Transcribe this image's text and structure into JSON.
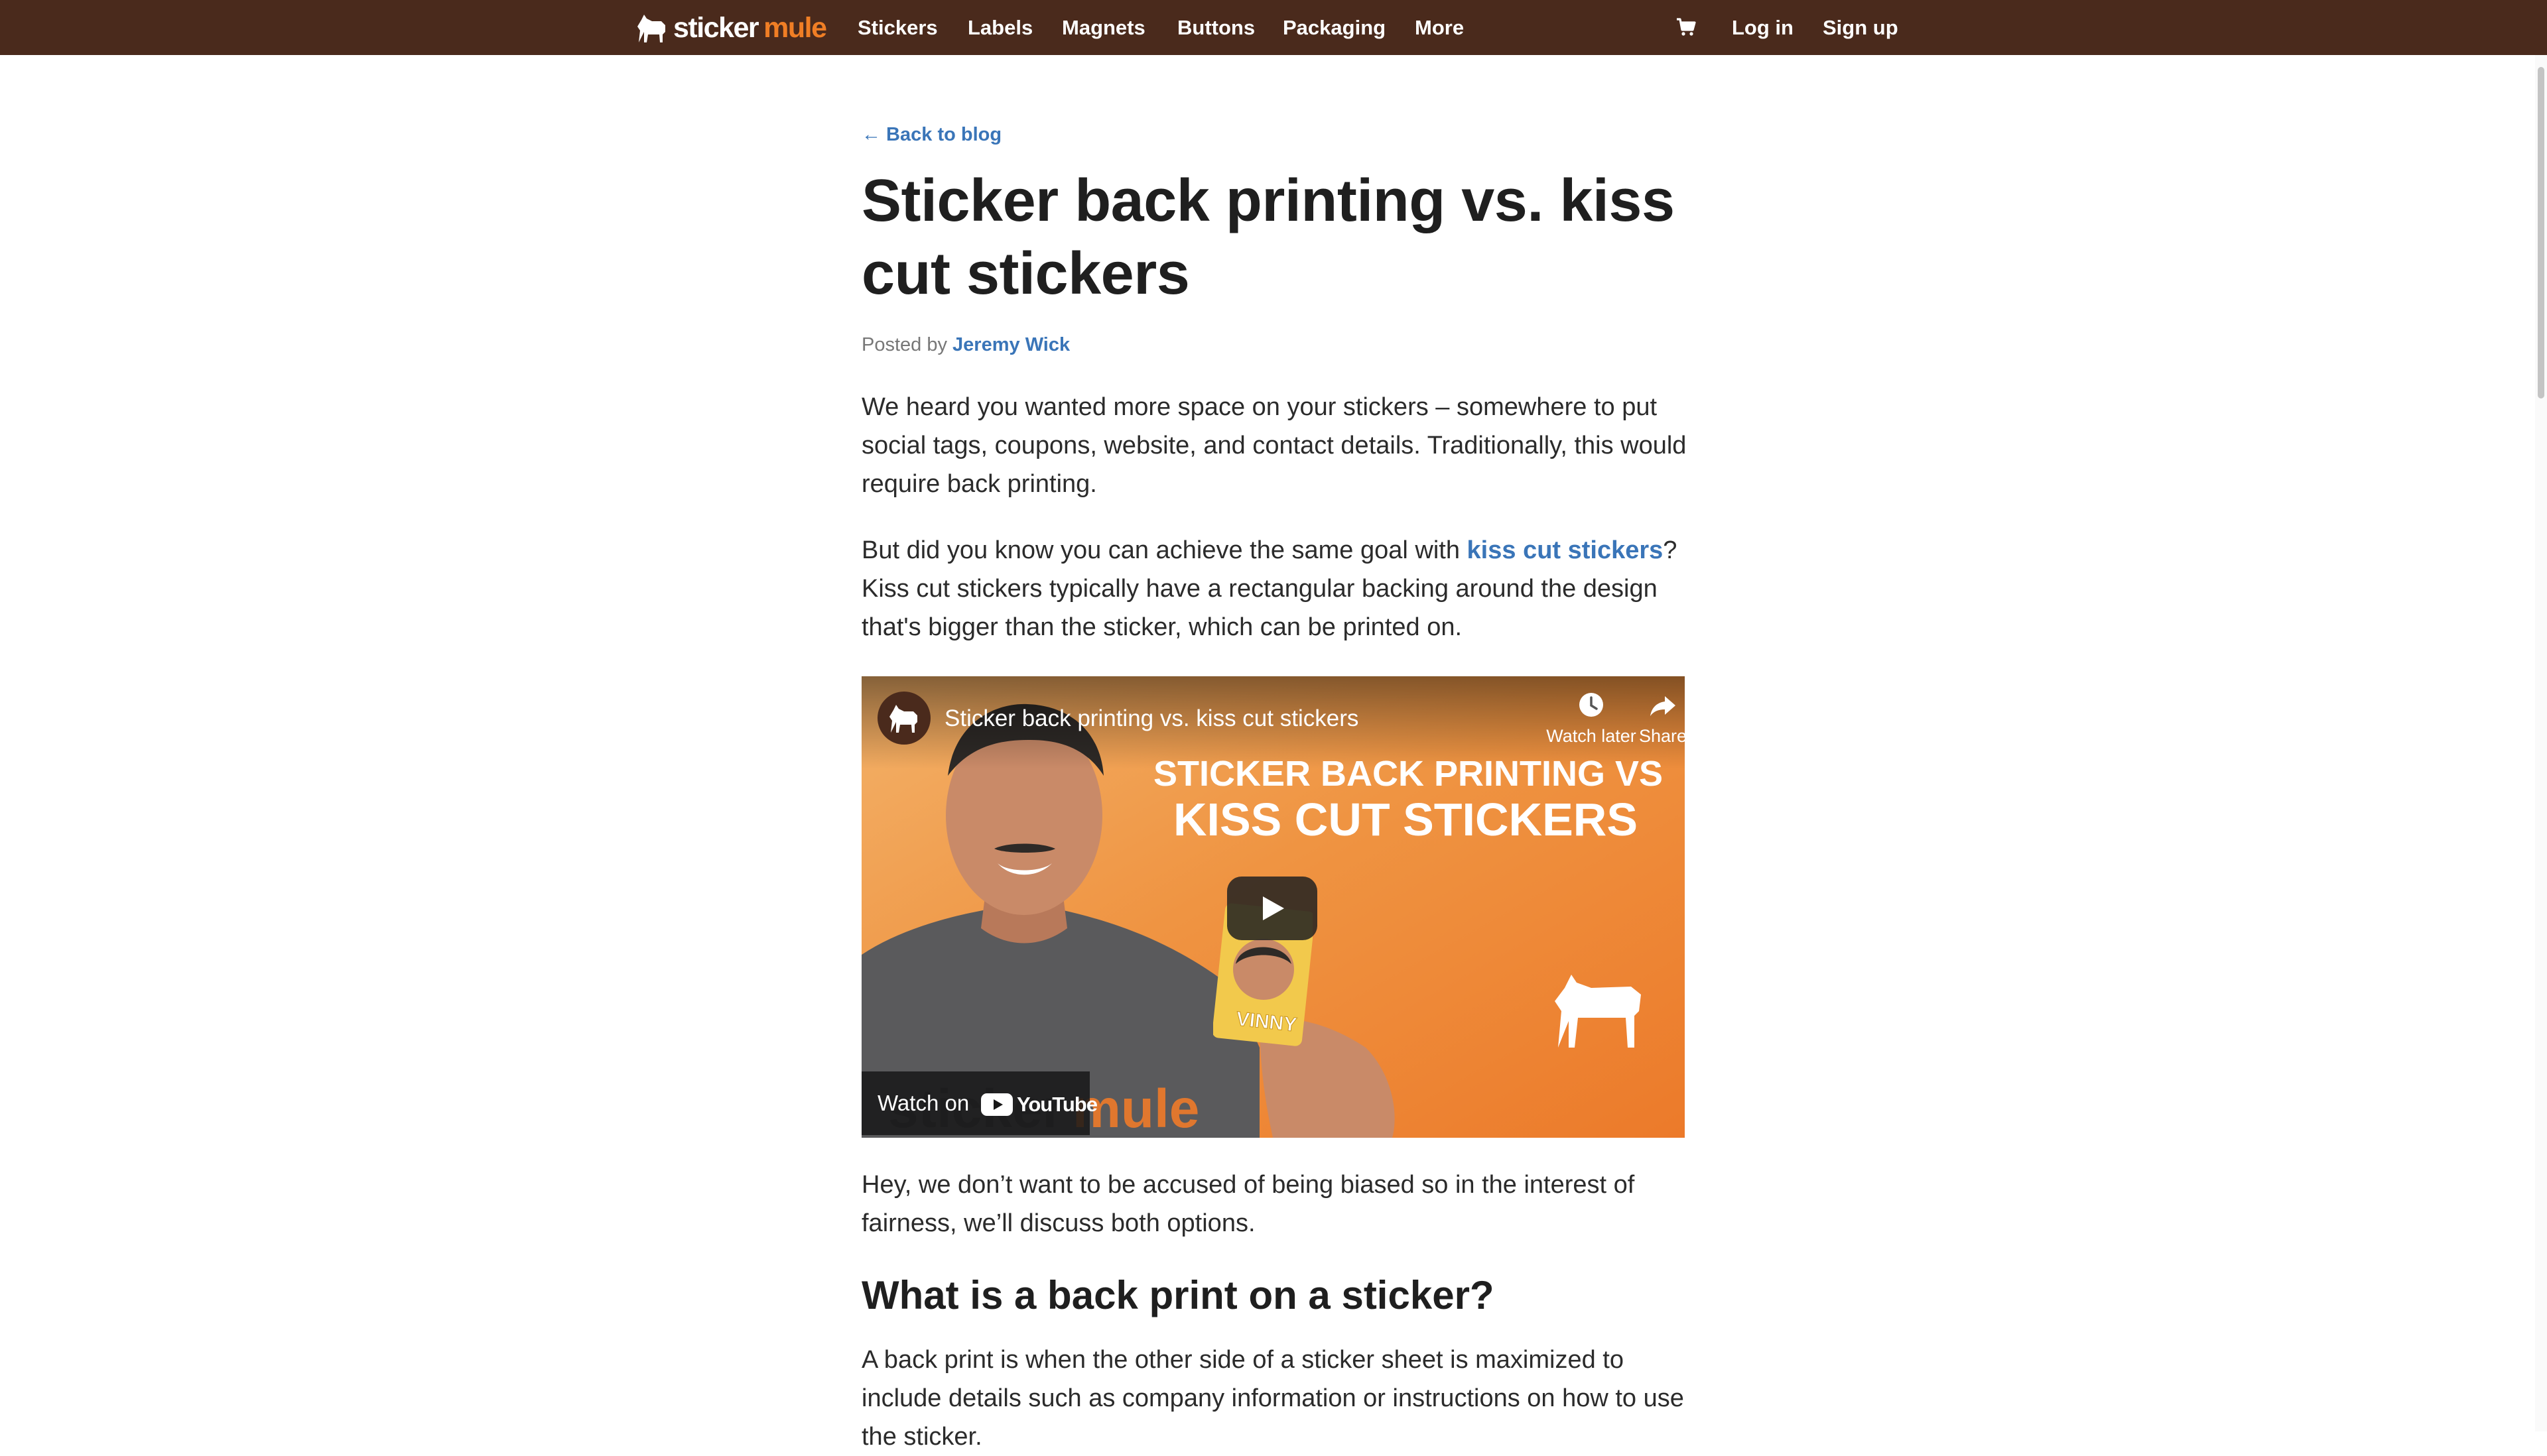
{
  "header": {
    "brand_white": "sticker",
    "brand_orange": "mule",
    "nav": [
      "Stickers",
      "Labels",
      "Magnets",
      "Buttons",
      "Packaging",
      "More"
    ],
    "login": "Log in",
    "signup": "Sign up",
    "cart_icon": "shopping-cart-icon"
  },
  "article": {
    "back_link": "← Back to blog",
    "title": "Sticker back printing vs. kiss cut stickers",
    "posted_by": "Posted by",
    "author": "Jeremy Wick",
    "p1": "We heard you wanted more space on your stickers – somewhere to put social tags, coupons, website, and contact details. Traditionally, this would require back printing.",
    "p2_before": "But did you know you can achieve the same goal with ",
    "p2_link": "kiss cut stickers",
    "p2_after": "? Kiss cut stickers typically have a rectangular backing around the design that's bigger than the sticker, which can be printed on.",
    "p3": "Hey, we don’t want to be accused of being biased so in the interest of fairness, we’ll discuss both options.",
    "h2": "What is a back print on a sticker?",
    "p4": "A back print is when the other side of a sticker sheet is maximized to include details such as company information or instructions on how to use the sticker."
  },
  "video": {
    "title": "Sticker back printing vs. kiss cut stickers",
    "watch_later": "Watch later",
    "share": "Share",
    "headline_line1": "STICKER BACK PRINTING VS",
    "headline_line2": "KISS CUT STICKERS",
    "watch_on": "Watch on",
    "youtube": "YouTube",
    "sticker_text": "VINNY",
    "shirt_text": "stickermule"
  },
  "colors": {
    "header_bg": "#4a2a1c",
    "brand_orange": "#f07e25",
    "link_blue": "#3a75b8",
    "video_orange": "#ef8c34"
  }
}
